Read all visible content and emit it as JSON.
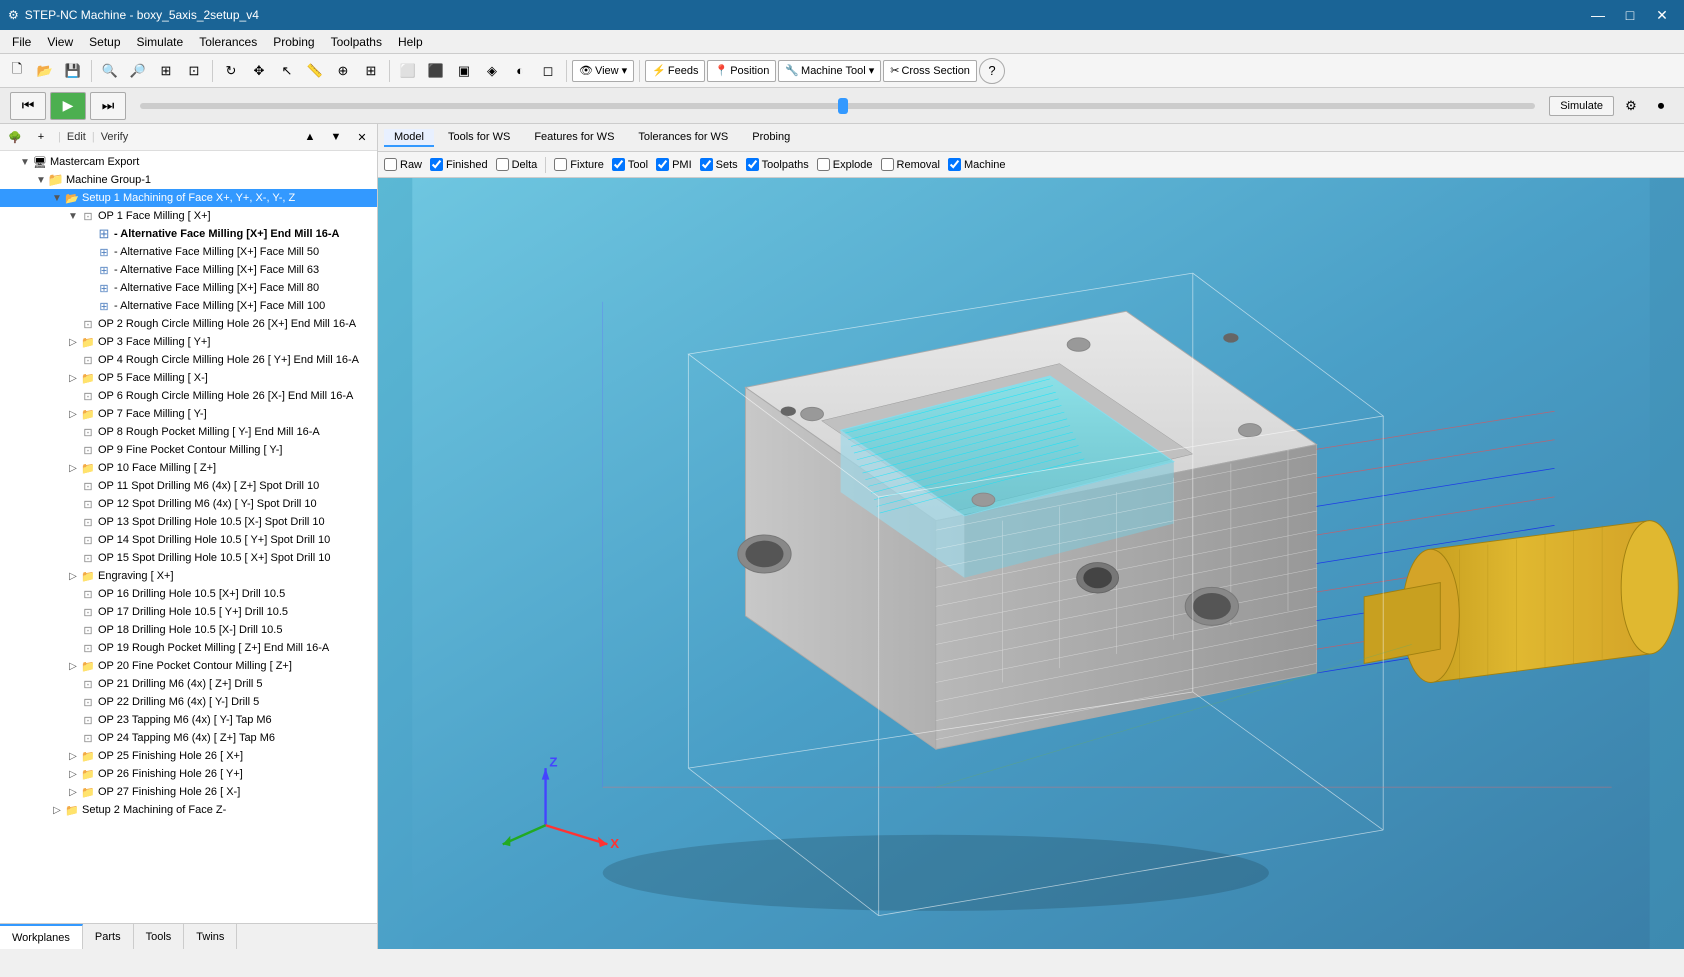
{
  "titlebar": {
    "title": "STEP-NC Machine - boxy_5axis_2setup_v4",
    "icon": "⚙"
  },
  "menubar": {
    "items": [
      "File",
      "View",
      "Setup",
      "Simulate",
      "Tolerances",
      "Probing",
      "Toolpaths",
      "Help"
    ]
  },
  "toolbar": {
    "view_label": "View ▾",
    "feeds_label": "Feeds",
    "position_label": "Position",
    "machine_tool_label": "Machine Tool ▾",
    "cross_section_label": "Cross Section",
    "help_btn": "?"
  },
  "playback": {
    "simulate_label": "Simulate"
  },
  "left_panel": {
    "edit_label": "Edit",
    "verify_label": "Verify",
    "tree": {
      "root": "Mastercam Export",
      "group": "Machine Group-1",
      "setup1": {
        "label": "Setup 1 Machining of Face X+, Y+, X-, Y-, Z",
        "selected": true,
        "children": [
          {
            "label": "OP 1 Face Milling [ X+]",
            "expanded": true,
            "children": [
              {
                "label": "- Alternative Face Milling [X+] End Mill 16-A",
                "bold": true
              },
              {
                "label": "- Alternative Face Milling [X+] Face Mill 50"
              },
              {
                "label": "- Alternative Face Milling [X+] Face Mill 63"
              },
              {
                "label": "- Alternative Face Milling [X+] Face Mill 80"
              },
              {
                "label": "- Alternative Face Milling [X+] Face Mill 100"
              }
            ]
          },
          {
            "label": "OP 2 Rough Circle Milling Hole 26 [X+] End Mill 16-A"
          },
          {
            "label": "OP 3 Face Milling [ Y+]"
          },
          {
            "label": "OP 4 Rough Circle Milling Hole 26 [ Y+] End Mill 16-A"
          },
          {
            "label": "OP 5 Face Milling [ X-]"
          },
          {
            "label": "OP 6 Rough Circle Milling Hole 26 [X-] End Mill 16-A"
          },
          {
            "label": "OP 7 Face Milling [ Y-]"
          },
          {
            "label": "OP 8 Rough Pocket Milling [ Y-] End Mill 16-A"
          },
          {
            "label": "OP 9 Fine Pocket Contour Milling [ Y-]"
          },
          {
            "label": "OP 10 Face Milling [ Z+]"
          },
          {
            "label": "OP 11 Spot Drilling M6 (4x) [ Z+] Spot Drill 10"
          },
          {
            "label": "OP 12 Spot Drilling M6 (4x) [ Y-] Spot Drill 10"
          },
          {
            "label": "OP 13 Spot Drilling Hole 10.5 [X-] Spot Drill 10"
          },
          {
            "label": "OP 14 Spot Drilling Hole 10.5 [ Y+] Spot Drill 10"
          },
          {
            "label": "OP 15 Spot Drilling Hole 10.5 [ X+] Spot Drill 10"
          },
          {
            "label": "Engraving [ X+]"
          },
          {
            "label": "OP 16 Drilling Hole 10.5 [X+] Drill 10.5"
          },
          {
            "label": "OP 17 Drilling Hole 10.5 [ Y+] Drill 10.5"
          },
          {
            "label": "OP 18 Drilling Hole 10.5 [X-] Drill 10.5"
          },
          {
            "label": "OP 19 Rough Pocket Milling [ Z+] End Mill 16-A"
          },
          {
            "label": "OP 20 Fine Pocket Contour Milling [ Z+]"
          },
          {
            "label": "OP 21 Drilling M6 (4x) [ Z+] Drill 5"
          },
          {
            "label": "OP 22 Drilling M6 (4x) [ Y-] Drill 5"
          },
          {
            "label": "OP 23 Tapping M6 (4x) [ Y-] Tap M6"
          },
          {
            "label": "OP 24 Tapping M6 (4x) [ Z+] Tap M6"
          },
          {
            "label": "OP 25 Finishing Hole 26 [ X+]"
          },
          {
            "label": "OP 26 Finishing Hole 26 [ Y+]"
          },
          {
            "label": "OP 27 Finishing Hole 26 [ X-]"
          }
        ]
      },
      "setup2": {
        "label": "Setup 2 Machining of Face Z-"
      }
    }
  },
  "bottom_tabs": [
    "Workplanes",
    "Parts",
    "Tools",
    "Twins"
  ],
  "right_panel": {
    "tabs": [
      "Model",
      "Tools for WS",
      "Features for WS",
      "Tolerances for WS",
      "Probing"
    ],
    "active_tab": "Model",
    "view_options": {
      "items": [
        {
          "label": "Raw",
          "checked": false
        },
        {
          "label": "Finished",
          "checked": true
        },
        {
          "label": "Delta",
          "checked": false
        },
        {
          "label": "Fixture",
          "checked": false
        },
        {
          "label": "Tool",
          "checked": true
        },
        {
          "label": "PMI",
          "checked": true
        },
        {
          "label": "Sets",
          "checked": true
        },
        {
          "label": "Toolpaths",
          "checked": true
        },
        {
          "label": "Explode",
          "checked": false
        },
        {
          "label": "Removal",
          "checked": false
        },
        {
          "label": "Machine",
          "checked": true
        }
      ]
    }
  },
  "colors": {
    "selection_bg": "#3399ff",
    "accent": "#1a6496",
    "folder": "#f0a020",
    "viewport_bg": "#4a9fc7"
  }
}
